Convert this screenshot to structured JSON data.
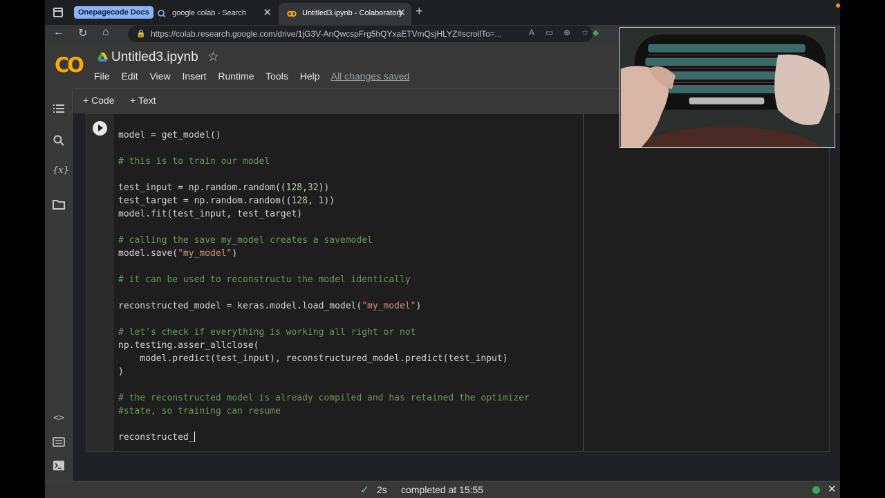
{
  "browser": {
    "tab_group_label": "Onepagecode Docs",
    "tabs": [
      {
        "label": "google colab - Search"
      },
      {
        "label": "Untitled3.ipynb - Colaboratory"
      }
    ],
    "url": "https://colab.research.google.com/drive/1jG3V-AnQwcspFrg5hQYxaETVmQsjHLYZ#scrollTo=...",
    "accent_color": "#8ab4f8"
  },
  "colab": {
    "logo_text": "CO",
    "notebook_title": "Untitled3.ipynb",
    "menu": [
      "File",
      "Edit",
      "View",
      "Insert",
      "Runtime",
      "Tools",
      "Help"
    ],
    "save_status": "All changes saved",
    "toolbar": {
      "code_label": "+ Code",
      "text_label": "+ Text"
    }
  },
  "cell": {
    "lines": [
      [
        {
          "t": "model = get_model()",
          "c": ""
        }
      ],
      [],
      [
        {
          "t": "# this is to train our model",
          "c": "cm"
        }
      ],
      [],
      [
        {
          "t": "test_input = np.random.random((",
          "c": ""
        },
        {
          "t": "128",
          "c": "nm"
        },
        {
          "t": ",",
          "c": ""
        },
        {
          "t": "32",
          "c": "nm"
        },
        {
          "t": "))",
          "c": ""
        }
      ],
      [
        {
          "t": "test_target = np.random.random((",
          "c": ""
        },
        {
          "t": "128",
          "c": "nm"
        },
        {
          "t": ", ",
          "c": ""
        },
        {
          "t": "1",
          "c": "nm"
        },
        {
          "t": "))",
          "c": ""
        }
      ],
      [
        {
          "t": "model.fit(test_input, test_target)",
          "c": ""
        }
      ],
      [],
      [
        {
          "t": "# calling the save my_model creates a savemodel",
          "c": "cm"
        }
      ],
      [
        {
          "t": "model.save(",
          "c": ""
        },
        {
          "t": "\"my_model\"",
          "c": "st"
        },
        {
          "t": ")",
          "c": ""
        }
      ],
      [],
      [
        {
          "t": "# it can be used to reconstructu the model identically",
          "c": "cm"
        }
      ],
      [],
      [
        {
          "t": "reconstructed_model = keras.model.load_model(",
          "c": ""
        },
        {
          "t": "\"my_model\"",
          "c": "st"
        },
        {
          "t": ")",
          "c": ""
        }
      ],
      [],
      [
        {
          "t": "# let's check if everything is working all right or not",
          "c": "cm"
        }
      ],
      [
        {
          "t": "np.testing.asser_allclose(",
          "c": ""
        }
      ],
      [
        {
          "t": "    model.predict(test_input), reconstructured_model.predict(test_input)",
          "c": ""
        }
      ],
      [
        {
          "t": ")",
          "c": ""
        }
      ],
      [],
      [
        {
          "t": "# the reconstructed model is already compiled and has retained the optimizer",
          "c": "cm"
        }
      ],
      [
        {
          "t": "#state, so training can resume",
          "c": "cm"
        }
      ],
      [],
      [
        {
          "t": "reconstructed_",
          "c": ""
        }
      ]
    ]
  },
  "status": {
    "duration": "2s",
    "completed_text": "completed at 15:55",
    "connected_color": "#34a853"
  }
}
